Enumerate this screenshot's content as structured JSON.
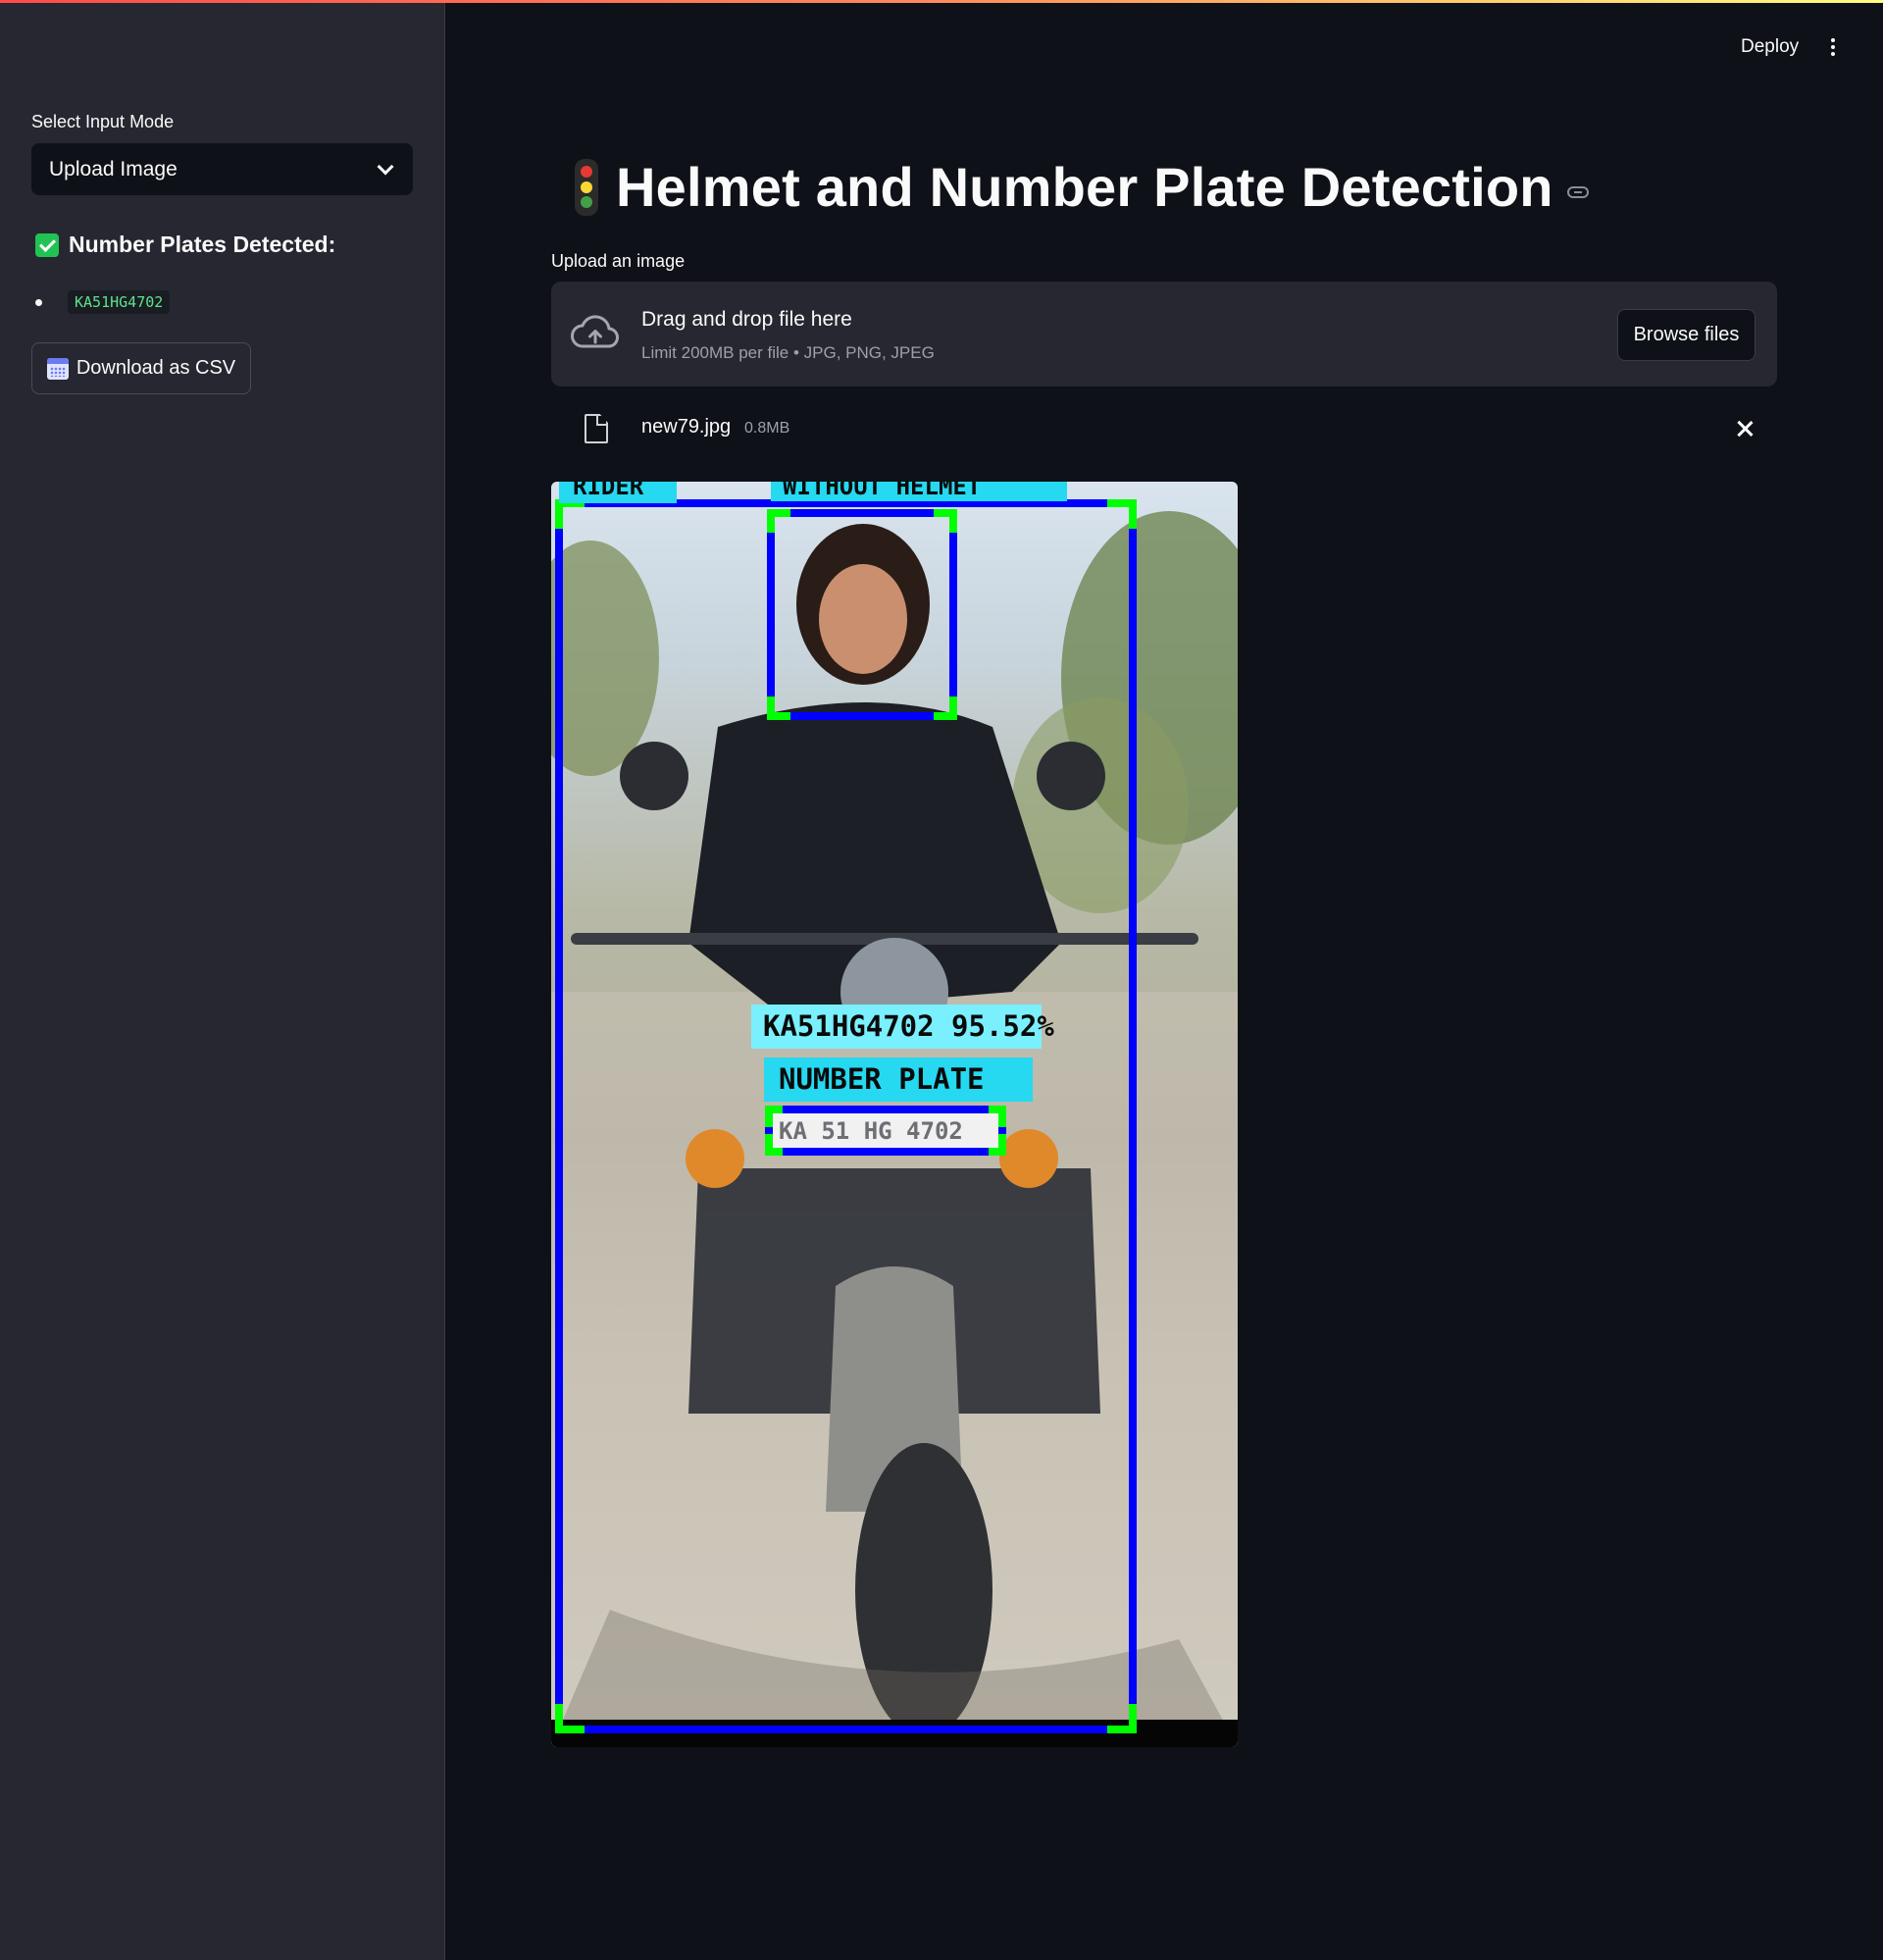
{
  "sidebar": {
    "input_mode_label": "Select Input Mode",
    "input_mode_value": "Upload Image",
    "detected_heading": "Number Plates Detected:",
    "plates": [
      "KA51HG4702"
    ],
    "download_label": "Download as CSV"
  },
  "header": {
    "deploy_label": "Deploy"
  },
  "main": {
    "title": "Helmet and Number Plate Detection",
    "upload_label": "Upload an image",
    "dropzone_title": "Drag and drop file here",
    "dropzone_sub": "Limit 200MB per file • JPG, PNG, JPEG",
    "browse_label": "Browse files",
    "file_name": "new79.jpg",
    "file_size": "0.8MB"
  },
  "detection": {
    "labels": {
      "rider": "RIDER",
      "without_helmet": "WITHOUT HELMET",
      "plate_reading": "KA51HG4702 95.52%",
      "number_plate": "NUMBER PLATE",
      "plate_text": "KA 51 HG 4702"
    }
  },
  "colors": {
    "accent_green": "#21c354",
    "box_blue": "#0000ff",
    "corner_green": "#00ff00",
    "label_cyan": "#26d8f0"
  }
}
